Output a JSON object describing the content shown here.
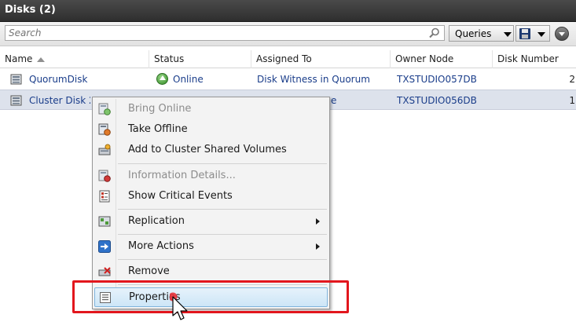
{
  "panel": {
    "title": "Disks (2)"
  },
  "search": {
    "placeholder": "Search"
  },
  "toolbar": {
    "queries_label": "Queries"
  },
  "columns": [
    "Name",
    "Status",
    "Assigned To",
    "Owner Node",
    "Disk Number"
  ],
  "rows": [
    {
      "name": "QuorumDisk",
      "status": "Online",
      "assigned_to": "Disk Witness in Quorum",
      "owner_node": "TXSTUDIO057DB",
      "disk_number": "2"
    },
    {
      "name": "Cluster Disk 2",
      "status": "",
      "assigned_to": "e",
      "owner_node": "TXSTUDIO056DB",
      "disk_number": "1"
    }
  ],
  "context_menu": {
    "items": [
      {
        "label": "Bring Online",
        "icon": "bring-online-icon",
        "enabled": false
      },
      {
        "label": "Take Offline",
        "icon": "take-offline-icon",
        "enabled": true
      },
      {
        "label": "Add to Cluster Shared Volumes",
        "icon": "add-csv-icon",
        "enabled": true
      },
      {
        "label": "Information Details...",
        "icon": "information-details-icon",
        "enabled": false
      },
      {
        "label": "Show Critical Events",
        "icon": "critical-events-icon",
        "enabled": true
      },
      {
        "label": "Replication",
        "icon": "replication-icon",
        "enabled": true,
        "submenu": true
      },
      {
        "label": "More Actions",
        "icon": "more-actions-icon",
        "enabled": true,
        "submenu": true
      },
      {
        "label": "Remove",
        "icon": "remove-icon",
        "enabled": true
      },
      {
        "label": "Properties",
        "icon": "properties-icon",
        "enabled": true,
        "highlighted": true
      }
    ]
  },
  "colors": {
    "title_bar": "#3a3a3a",
    "link_text": "#1a3d8a",
    "selected_row": "#dde2ec",
    "menu_highlight": "#cde6f7",
    "annotation_red": "#e2161d"
  }
}
